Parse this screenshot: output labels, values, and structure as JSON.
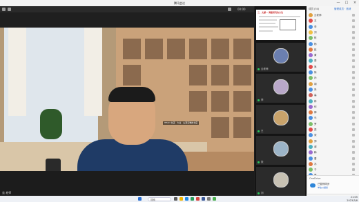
{
  "window": {
    "title": "腾讯会议",
    "minimize": "—",
    "maximize": "□",
    "close": "×"
  },
  "toolbar": {
    "clock": "00:00"
  },
  "main_video": {
    "speaker_name": "云 老师",
    "sign_text": "HEAD 书店 · 大业 · 山顶云端的书店"
  },
  "slide": {
    "title": "三、文献… 调查研究的方法"
  },
  "video_tiles": [
    {
      "name": "云老师",
      "avatar_color": "#6b7fb0"
    },
    {
      "name": "李",
      "avatar_color": "#b9a8c9"
    },
    {
      "name": "王",
      "avatar_color": "#c9a36b"
    },
    {
      "name": "张",
      "avatar_color": "#9cb4c7"
    },
    {
      "name": "刘",
      "avatar_color": "#c7c1b3"
    }
  ],
  "participants_panel": {
    "header": "成员 (54)",
    "manage": "管理成员 · 邀请",
    "members": [
      {
        "name": "云老师",
        "color": "#e0a040"
      },
      {
        "name": "王",
        "color": "#e24a4a"
      },
      {
        "name": "李",
        "color": "#4a90e2"
      },
      {
        "name": "刘",
        "color": "#f0c040"
      },
      {
        "name": "陈",
        "color": "#7cbf6a"
      },
      {
        "name": "杨",
        "color": "#4a90e2"
      },
      {
        "name": "赵",
        "color": "#e07840"
      },
      {
        "name": "黄",
        "color": "#9a6ad0"
      },
      {
        "name": "周",
        "color": "#4ab0c0"
      },
      {
        "name": "吴",
        "color": "#e24a4a"
      },
      {
        "name": "徐",
        "color": "#4a90e2"
      },
      {
        "name": "孙",
        "color": "#7cbf6a"
      },
      {
        "name": "胡",
        "color": "#e0a040"
      },
      {
        "name": "朱",
        "color": "#4a90e2"
      },
      {
        "name": "高",
        "color": "#d0605a"
      },
      {
        "name": "林",
        "color": "#4ab0c0"
      },
      {
        "name": "何",
        "color": "#9a6ad0"
      },
      {
        "name": "郭",
        "color": "#e07840"
      },
      {
        "name": "马",
        "color": "#4a90e2"
      },
      {
        "name": "罗",
        "color": "#7cbf6a"
      },
      {
        "name": "梁",
        "color": "#e24a4a"
      },
      {
        "name": "宋",
        "color": "#4a90e2"
      },
      {
        "name": "郑",
        "color": "#e0a040"
      },
      {
        "name": "谢",
        "color": "#4ab0c0"
      },
      {
        "name": "韩",
        "color": "#9a6ad0"
      },
      {
        "name": "唐",
        "color": "#4a90e2"
      },
      {
        "name": "冯",
        "color": "#e07840"
      },
      {
        "name": "于",
        "color": "#7cbf6a"
      },
      {
        "name": "董",
        "color": "#4a90e2"
      }
    ]
  },
  "toast": {
    "title": "OneDrive",
    "text": "已暂停同步",
    "subtext": "单击以继续"
  },
  "taskbar": {
    "search": "搜索",
    "time": "21:05",
    "date": "2023/3/8"
  }
}
